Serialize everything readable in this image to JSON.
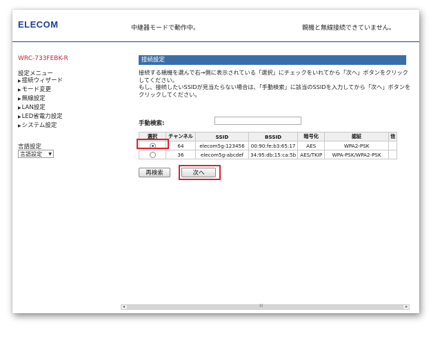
{
  "header": {
    "brand": "ELECOM",
    "mode_status": "中継器モードで動作中。",
    "link_status": "親機と無線接続できていません。"
  },
  "sidebar": {
    "model": "WRC-733FEBK-R",
    "menu_title": "設定メニュー",
    "items": [
      {
        "label": "接続ウィザード"
      },
      {
        "label": "モード変更"
      },
      {
        "label": "無線設定"
      },
      {
        "label": "LAN設定"
      },
      {
        "label": "LED省電力設定"
      },
      {
        "label": "システム設定"
      }
    ],
    "language_label": "言語設定",
    "language_select_value": "言語設定"
  },
  "main": {
    "section_title": "接続設定",
    "instructions_1": "接続する親機を選んで右→側に表示されている「選択」にチェックをいれてから「次へ」ボタンをクリックしてください。",
    "instructions_2": "もし、接続したいSSIDが見当たらない場合は、「手動検索」に該当のSSIDを入力してから「次へ」ボタンをクリックしてください。",
    "manual_search_label": "手動検索:",
    "manual_search_value": "",
    "table": {
      "headers": [
        "選択",
        "チャンネル",
        "SSID",
        "BSSID",
        "暗号化",
        "認証",
        "信"
      ],
      "rows": [
        {
          "selected": true,
          "channel": "64",
          "ssid": "elecom5g-123456",
          "bssid": "00:90:fe:b3:65:17",
          "encryption": "AES",
          "auth": "WPA2-PSK"
        },
        {
          "selected": false,
          "channel": "36",
          "ssid": "elecom5g-abcdef",
          "bssid": "34:95:db:15:ca:5b",
          "encryption": "AES/TKIP",
          "auth": "WPA-PSK/WPA2-PSK"
        }
      ]
    },
    "rescan_button": "再検索",
    "next_button": "次へ"
  },
  "scrollbar": {
    "left_arrow": "◂",
    "right_arrow": "▸",
    "grip": "III"
  },
  "colors": {
    "brand_blue": "#1c3f94",
    "section_bar": "#3a6ea8",
    "model_red": "#c8202f",
    "highlight_red": "#d8202c"
  }
}
